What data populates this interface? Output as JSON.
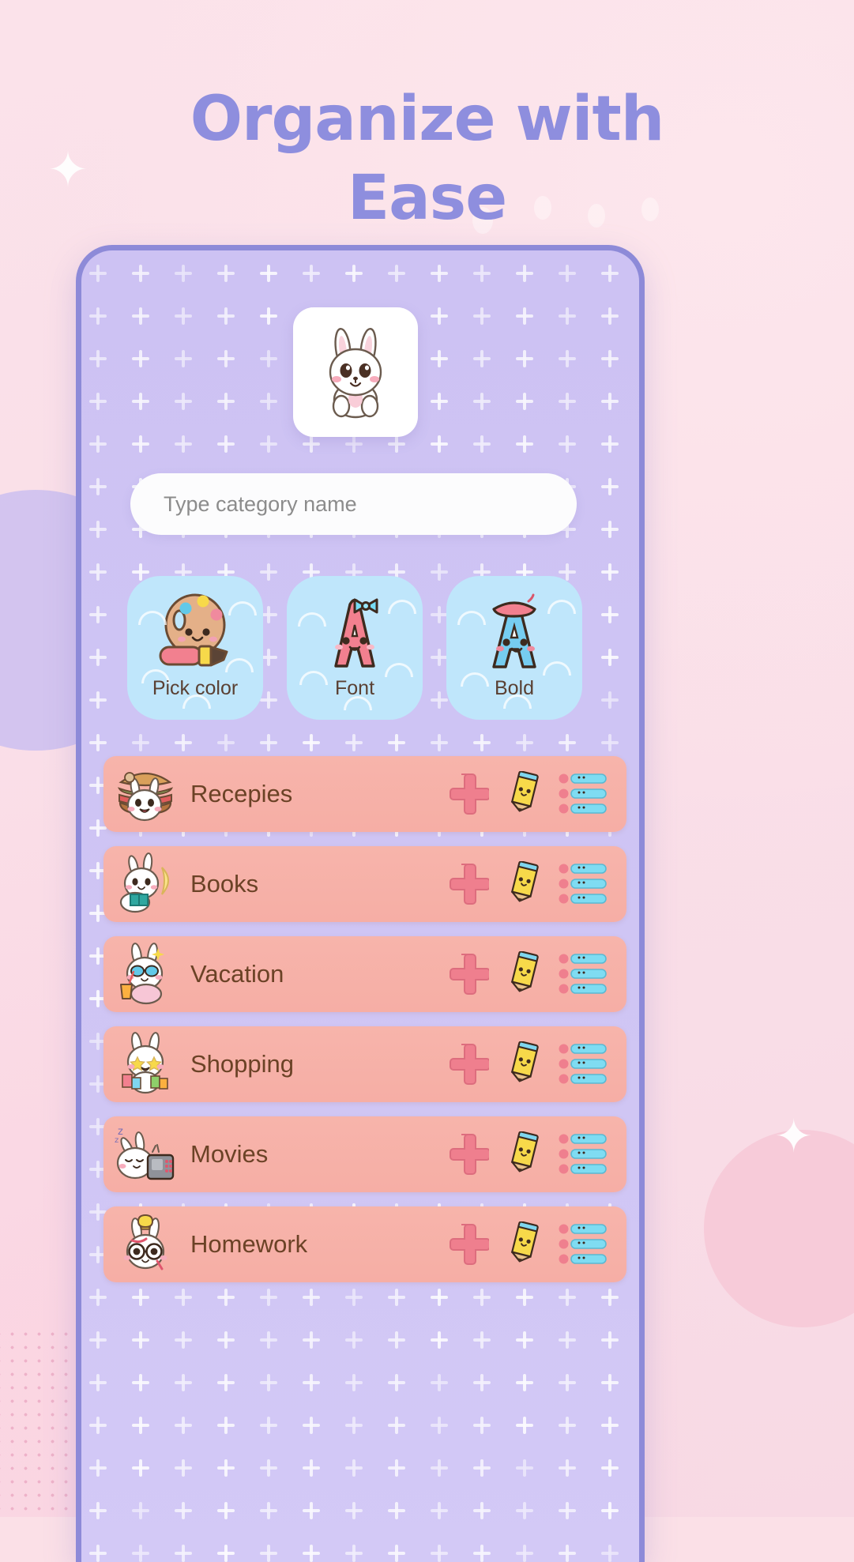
{
  "headline": {
    "line1": "Organize with",
    "line2": "Ease",
    "color": "#8e8ede"
  },
  "phone": {
    "avatar": {
      "icon": "bunny-avatar-icon"
    },
    "input": {
      "placeholder": "Type category name",
      "value": ""
    },
    "tools": [
      {
        "label": "Pick color",
        "icon": "palette-brush-icon",
        "bg": "#bfe6fb"
      },
      {
        "label": "Font",
        "icon": "letter-a-bow-icon",
        "bg": "#bfe6fb"
      },
      {
        "label": "Bold",
        "icon": "letter-a-beret-icon",
        "bg": "#bfe6fb"
      }
    ],
    "categories": [
      {
        "name": "Recepies",
        "icon": "bunny-burger-icon"
      },
      {
        "name": "Books",
        "icon": "bunny-reading-icon"
      },
      {
        "name": "Vacation",
        "icon": "bunny-sunglasses-icon"
      },
      {
        "name": "Shopping",
        "icon": "bunny-shopping-icon"
      },
      {
        "name": "Movies",
        "icon": "bunny-tv-icon"
      },
      {
        "name": "Homework",
        "icon": "bunny-glasses-icon"
      }
    ],
    "row_actions": [
      {
        "icon": "plus-icon"
      },
      {
        "icon": "pencil-icon"
      },
      {
        "icon": "checklist-icon"
      }
    ],
    "colors": {
      "screen_bg_top": "#cdc2f3",
      "screen_bg_bottom": "#d3c9f6",
      "row_bg": "#f7b4ab",
      "row_text": "#6b4226",
      "plus_accent": "#ef7f8e",
      "tool_bg": "#bfe6fb",
      "phone_border": "#8d8ad8"
    }
  }
}
